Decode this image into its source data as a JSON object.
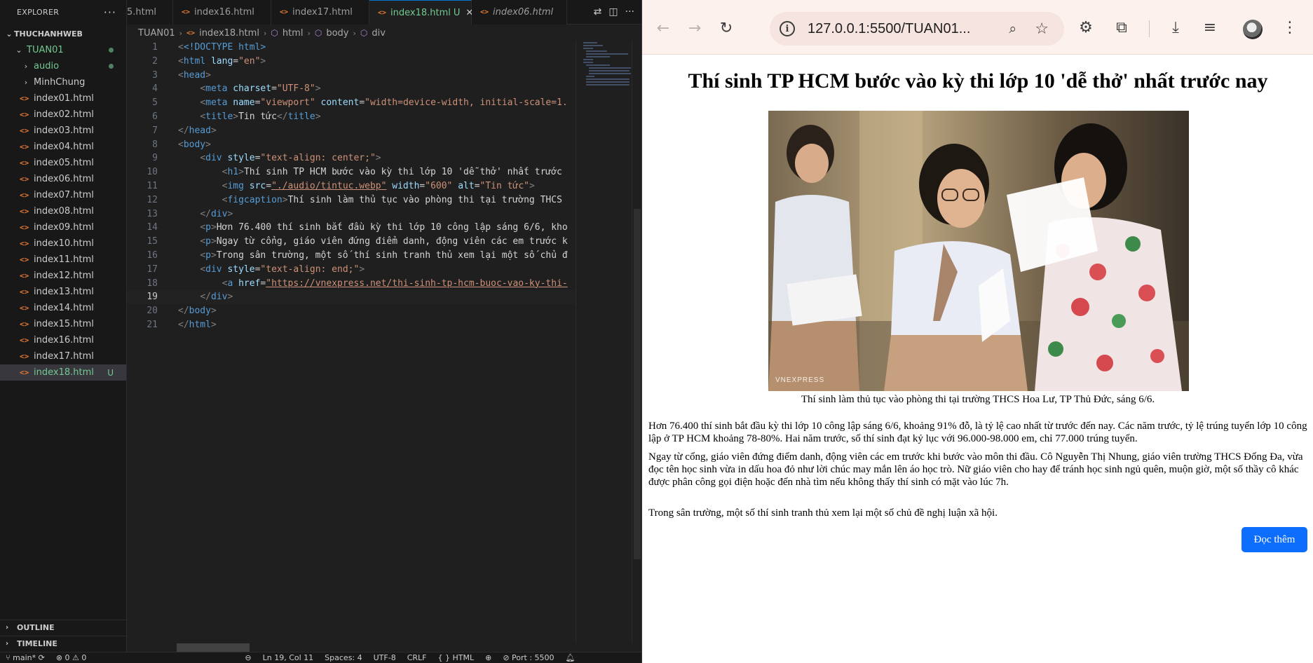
{
  "vscode": {
    "explorer_title": "EXPLORER",
    "workspace": "THUCHANHWEB",
    "project": "TUAN01",
    "folders": [
      "audio",
      "MinhChung"
    ],
    "files": [
      "index01.html",
      "index02.html",
      "index03.html",
      "index04.html",
      "index05.html",
      "index06.html",
      "index07.html",
      "index08.html",
      "index09.html",
      "index10.html",
      "index11.html",
      "index12.html",
      "index13.html",
      "index14.html",
      "index15.html",
      "index16.html",
      "index17.html",
      "index18.html"
    ],
    "selected_file_badge": "U",
    "outline": "OUTLINE",
    "timeline": "TIMELINE",
    "tabs": [
      {
        "label": "5.html"
      },
      {
        "label": "index16.html"
      },
      {
        "label": "index17.html"
      },
      {
        "label": "index18.html",
        "badge": "U"
      },
      {
        "label": "index06.html"
      }
    ],
    "breadcrumb": [
      "TUAN01",
      "index18.html",
      "html",
      "body",
      "div"
    ],
    "line_numbers": [
      "1",
      "2",
      "3",
      "4",
      "5",
      "6",
      "7",
      "8",
      "9",
      "10",
      "11",
      "12",
      "13",
      "14",
      "15",
      "16",
      "17",
      "18",
      "19",
      "20",
      "21"
    ],
    "code": {
      "l1": "<!DOCTYPE html>",
      "l2_lang": "\"en\"",
      "l5_charset": "\"UTF-8\"",
      "l5_name": "\"viewport\"",
      "l5_content": "\"width=device-width, initial-scale=1.",
      "l7_title": "Tin tức",
      "l9_style": "\"text-align: center;\"",
      "l10_text": "Thí sinh TP HCM bước vào kỳ thi lớp 10 'dễ thở' nhất trước",
      "l11_src": "\"./audio/tintuc.webp\"",
      "l11_width": "\"600\"",
      "l11_alt": "\"Tin tức\"",
      "l12_text": "Thí sinh làm thủ tục vào phòng thi tại trường THCS",
      "l14_text": "Hơn 76.400 thí sinh bắt đầu kỳ thi lớp 10 công lập sáng 6/6, kho",
      "l15_text": "Ngay từ cổng, giáo viên đứng điểm danh, động viên các em trước k",
      "l16_text": "Trong sân trường, một số thí sinh tranh thủ xem lại một số chủ đ",
      "l17_style": "\"text-align: end;\"",
      "l18_href": "\"https://vnexpress.net/thi-sinh-tp-hcm-buoc-vao-ky-thi-"
    },
    "status": {
      "branch": "main*",
      "errors": "⊗ 0 ⚠ 0",
      "position": "Ln 19, Col 11",
      "spaces": "Spaces: 4",
      "encoding": "UTF-8",
      "eol": "CRLF",
      "language": "{ } HTML",
      "port": "Port : 5500"
    }
  },
  "browser": {
    "url": "127.0.0.1:5500/TUAN01...",
    "accent": "#0d6efd",
    "page": {
      "heading": "Thí sinh TP HCM bước vào kỳ thi lớp 10 'dễ thở' nhất trước nay",
      "image_watermark": "VNEXPRESS",
      "caption": "Thí sinh làm thủ tục vào phòng thi tại trường THCS Hoa Lư, TP Thủ Đức, sáng 6/6.",
      "p1": "Hơn 76.400 thí sinh bắt đầu kỳ thi lớp 10 công lập sáng 6/6, khoảng 91% đỗ, là tỷ lệ cao nhất từ trước đến nay. Các năm trước, tỷ lệ trúng tuyển lớp 10 công lập ở TP HCM khoảng 78-80%. Hai năm trước, số thí sinh đạt kỷ lục với 96.000-98.000 em, chỉ 77.000 trúng tuyển.",
      "p2": "Ngay từ cổng, giáo viên đứng điểm danh, động viên các em trước khi bước vào môn thi đầu. Cô Nguyễn Thị Nhung, giáo viên trường THCS Đống Đa, vừa đọc tên học sinh vừa in dấu hoa đỏ như lời chúc may mắn lên áo học trò. Nữ giáo viên cho hay để tránh học sinh ngủ quên, muộn giờ, một số thầy cô khác được phân công gọi điện hoặc đến nhà tìm nếu không thấy thí sinh có mặt vào lúc 7h.",
      "p3": "Trong sân trường, một số thí sinh tranh thủ xem lại một số chủ đề nghị luận xã hội.",
      "read_more": "Đọc thêm"
    }
  }
}
